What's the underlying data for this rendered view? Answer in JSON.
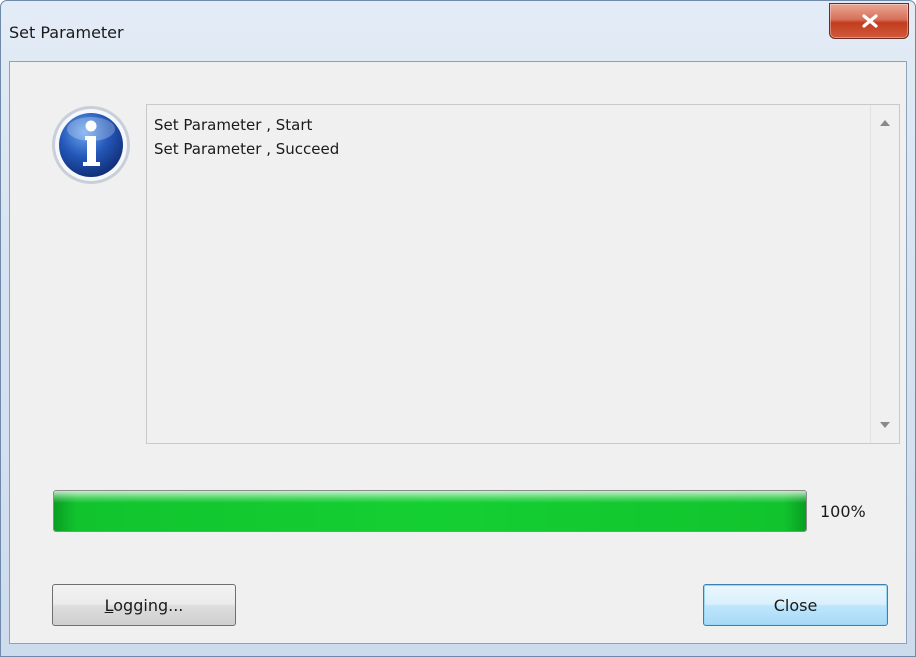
{
  "window": {
    "title": "Set Parameter"
  },
  "icons": {
    "info": "info-icon",
    "close": "close-icon",
    "scroll_up": "scroll-up-arrow-icon",
    "scroll_down": "scroll-down-arrow-icon"
  },
  "log": {
    "lines": [
      "Set Parameter , Start",
      "Set Parameter , Succeed"
    ]
  },
  "progress": {
    "value": 1.0,
    "label": "100%",
    "color": "#14cf32"
  },
  "buttons": {
    "logging": "Logging...",
    "close": "Close"
  }
}
